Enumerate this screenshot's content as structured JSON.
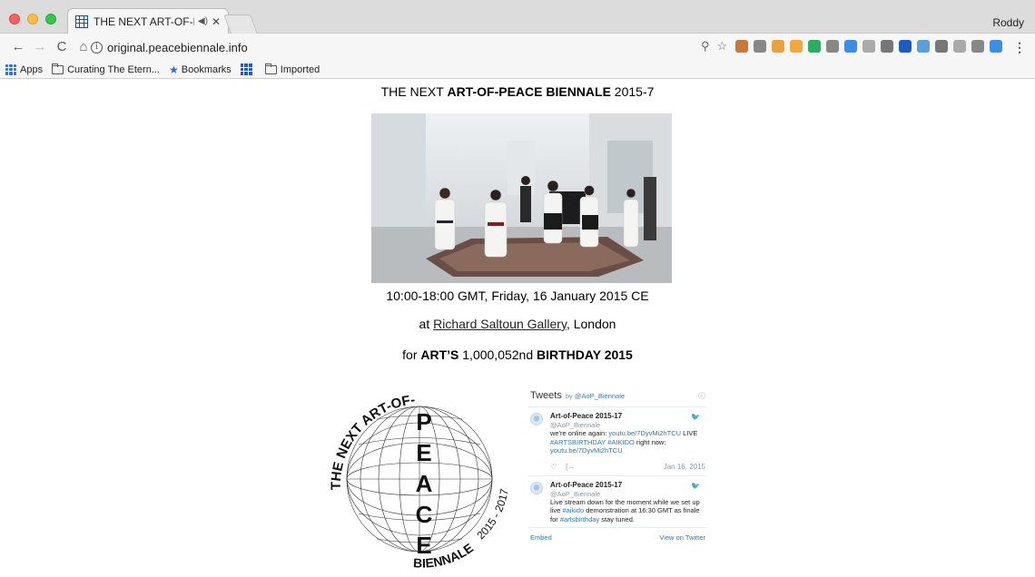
{
  "browser": {
    "tab": {
      "title": "THE NEXT ART-OF-PEACE",
      "audio_icon": "speaker-icon"
    },
    "user_name": "Roddy",
    "nav": {
      "back": "←",
      "forward": "→",
      "reload": "C",
      "home": "⌂"
    },
    "url": "original.peacebiennale.info",
    "bookmarks": [
      {
        "label": "Apps",
        "icon": "apps-icon"
      },
      {
        "label": "Curating The Etern...",
        "icon": "folder-icon"
      },
      {
        "label": "Bookmarks",
        "icon": "star-icon"
      },
      {
        "label": "",
        "icon": "grid-icon"
      },
      {
        "label": "Imported",
        "icon": "folder-icon"
      }
    ],
    "extension_colors": [
      "#c8783a",
      "#888888",
      "#e8a43a",
      "#f2a93b",
      "#27ae60",
      "#888888",
      "#3a8ee8",
      "#aaaaaa",
      "#777777",
      "#1e5cc4",
      "#5aa0d8",
      "#777777",
      "#aaaaaa",
      "#888888",
      "#3a8ee8"
    ]
  },
  "page": {
    "title_pre": "THE NEXT ",
    "title_bold": "ART-OF-PEACE BIENNALE",
    "title_post": " 2015-7",
    "time_line": "10:00-18:00 GMT, Friday, 16 January 2015 CE",
    "at_pre": "at ",
    "gallery_link": "Richard Saltoun Gallery",
    "at_post": ", London",
    "for_pre": "for ",
    "for_bold1": "ART’S",
    "for_mid": " 1,000,052nd ",
    "for_bold2": "BIRTHDAY 2015",
    "logo": {
      "arc_top": "THE NEXT ART-OF-",
      "letters": [
        "P",
        "E",
        "A",
        "C",
        "E"
      ],
      "arc_bottom": "BIENNALE",
      "arc_right": "2015 - 2017"
    }
  },
  "twitter": {
    "heading": "Tweets",
    "by": "by",
    "handle": "@AoP_Biennale",
    "info": "ⓘ",
    "tweets": [
      {
        "name": "Art-of-Peace 2015-17",
        "handle": "@AoP_Biennale",
        "text_pre": "we're online again: ",
        "link1": "youtu.be/7DyvMi2hTCU",
        "text_mid": " LIVE ",
        "tag1": "#ARTSBIRTHDAY",
        "text_sp": " ",
        "tag2": "#AIKIDO",
        "text_post": " right now: ",
        "link2": "youtu.be/7DyvMi2hTCU",
        "date": "Jan 16, 2015"
      },
      {
        "name": "Art-of-Peace 2015-17",
        "handle": "@AoP_Biennale",
        "text_pre": "Live stream down for the moment while we set up live ",
        "tag1": "#aikido",
        "text_mid": " demonstration at 16:30 GMT as finale for ",
        "tag2": "#artsbirthday",
        "text_post": " stay tuned."
      }
    ],
    "embed": "Embed",
    "view": "View on Twitter"
  }
}
